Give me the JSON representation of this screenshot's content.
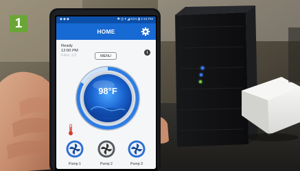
{
  "badge": {
    "number": "1"
  },
  "app": {
    "status_bar_left": "◆ ◆ ◆",
    "status_bar_right": "✱ ◎ ▾ ◢ 91% ▮ 4:18 PM",
    "title": "HOME",
    "status": {
      "state": "Ready",
      "time": "12:00 PM",
      "filter": "Filter 1/2"
    },
    "menu_label": "MENU",
    "temperature": "98°F",
    "pumps": [
      {
        "label": "Pump 1"
      },
      {
        "label": "Pump 2"
      },
      {
        "label": "Pump 3"
      }
    ]
  },
  "colors": {
    "app_bar": "#1769d4",
    "status_bar": "#0b4fa8",
    "badge": "#6aa636",
    "led_blue": "#3c7bff",
    "led_green": "#6fd44c"
  },
  "icons": [
    "gear-icon",
    "info-icon",
    "thermometer-icon",
    "pump-icon"
  ]
}
